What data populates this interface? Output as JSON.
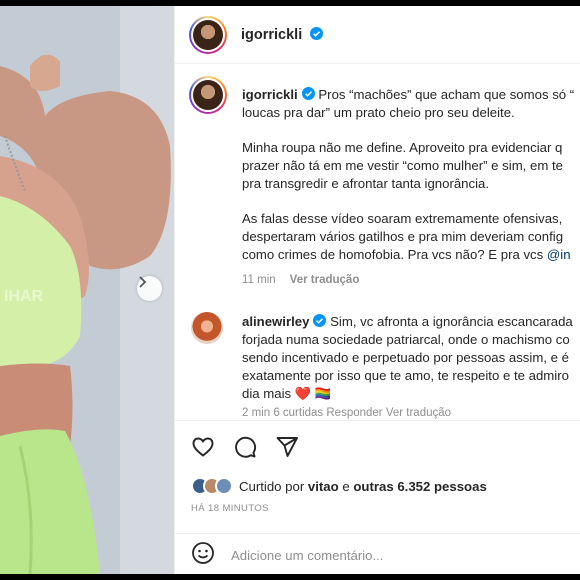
{
  "post": {
    "username": "igorrickli",
    "verified": true
  },
  "caption": {
    "username": "igorrickli",
    "line1": "Pros “machões” que acham que somos só “",
    "line2": "loucas pra dar” um prato cheio pro seu deleite.",
    "para2": [
      "Minha roupa não me define. Aproveito pra evidenciar q",
      "prazer não tá em me vestir “como mulher” e sim, em te",
      "pra transgredir e afrontar tanta ignorância."
    ],
    "para3": [
      "As falas desse vídeo soaram extremamente ofensivas,",
      "despertaram vários gatilhos e pra mim deveriam config",
      "como crimes de homofobia. Pra vcs não? E pra vcs "
    ],
    "mention": "@in",
    "time": "11 min",
    "see_translation": "Ver tradução"
  },
  "comment": {
    "username": "alinewirley",
    "text_first": "Sim, vc afronta a ignorância escancarada",
    "lines": [
      "forjada numa sociedade patriarcal, onde o machismo co",
      "sendo incentivado e perpetuado por pessoas assim, e é",
      "exatamente por isso que te amo, te respeito e te admiro",
      "dia mais"
    ],
    "emojis": "❤️ 🏳️‍🌈",
    "meta": "2 min   6 curtidas   Responder   Ver tradução"
  },
  "actions": {
    "liked_by_prefix": "Curtido por ",
    "liked_by_user": "vitao",
    "liked_by_mid": " e ",
    "liked_by_others": "outras 6.352 pessoas",
    "date": "HÁ 18 MINUTOS"
  },
  "add_comment": {
    "placeholder": "Adicione um comentário..."
  },
  "icons": {
    "like": "heart-icon",
    "comment": "comment-icon",
    "share": "share-icon",
    "emoji": "emoji-icon",
    "verified": "verified-badge-icon",
    "next": "chevron-right-icon"
  },
  "colors": {
    "verified": "#0095f6",
    "text": "#262626",
    "muted": "#8e8e8e",
    "mention": "#00376b"
  }
}
